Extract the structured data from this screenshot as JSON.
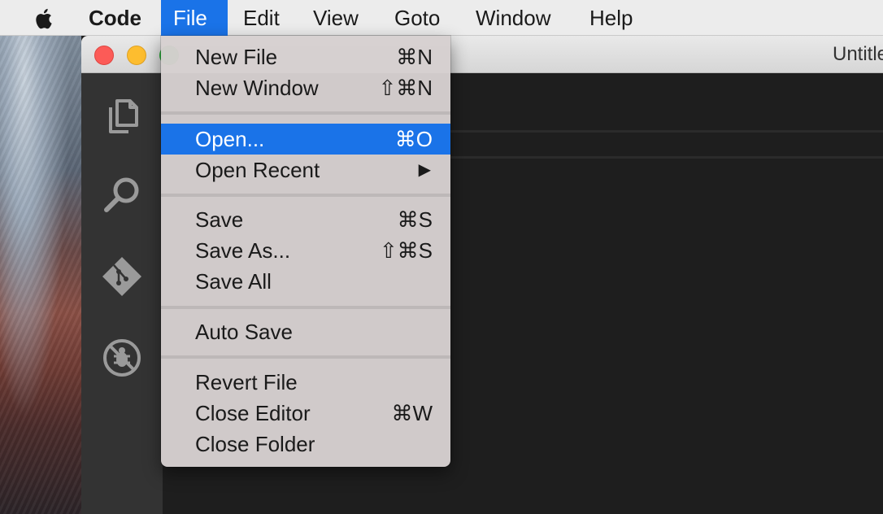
{
  "menubar": {
    "app_name": "Code",
    "items": [
      {
        "label": "File",
        "active": true
      },
      {
        "label": "Edit"
      },
      {
        "label": "View"
      },
      {
        "label": "Goto"
      },
      {
        "label": "Window"
      },
      {
        "label": "Help"
      }
    ]
  },
  "window": {
    "title": "Untitled"
  },
  "file_menu": {
    "groups": [
      [
        {
          "label": "New File",
          "shortcut": "⌘N"
        },
        {
          "label": "New Window",
          "shortcut": "⇧⌘N"
        }
      ],
      [
        {
          "label": "Open...",
          "shortcut": "⌘O",
          "highlighted": true
        },
        {
          "label": "Open Recent",
          "shortcut": "▶"
        }
      ],
      [
        {
          "label": "Save",
          "shortcut": "⌘S"
        },
        {
          "label": "Save As...",
          "shortcut": "⇧⌘S"
        },
        {
          "label": "Save All",
          "shortcut": ""
        }
      ],
      [
        {
          "label": "Auto Save",
          "shortcut": ""
        }
      ],
      [
        {
          "label": "Revert File",
          "shortcut": ""
        },
        {
          "label": "Close Editor",
          "shortcut": "⌘W"
        },
        {
          "label": "Close Folder",
          "shortcut": ""
        }
      ]
    ]
  },
  "activity_bar": {
    "icons": [
      "files-icon",
      "search-icon",
      "git-icon",
      "debug-icon"
    ]
  },
  "colors": {
    "highlight": "#1a73e8",
    "menubar": "#ececec",
    "activity_bar": "#333333",
    "editor": "#1e1e1e"
  }
}
